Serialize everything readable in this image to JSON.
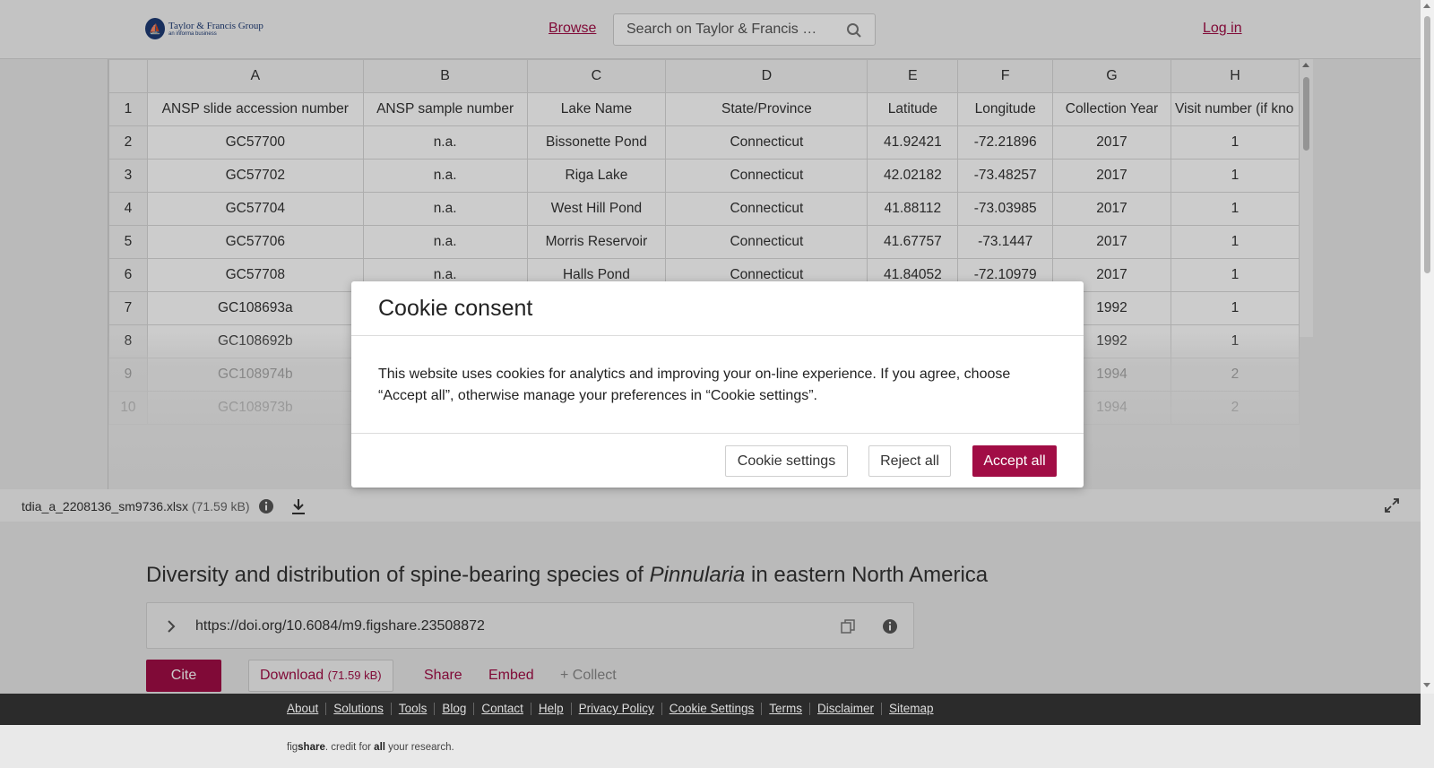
{
  "header": {
    "logo_main": "Taylor & Francis Group",
    "logo_sub": "an informa business",
    "browse_label": "Browse",
    "search_placeholder": "Search on Taylor & Francis …",
    "login_label": "Log in"
  },
  "sheet": {
    "columns": [
      "A",
      "B",
      "C",
      "D",
      "E",
      "F",
      "G",
      "H"
    ],
    "rows": [
      {
        "n": "1",
        "cells": [
          "ANSP slide accession number",
          "ANSP sample number",
          "Lake Name",
          "State/Province",
          "Latitude",
          "Longitude",
          "Collection Year",
          "Visit number (if kno"
        ]
      },
      {
        "n": "2",
        "cells": [
          "GC57700",
          "n.a.",
          "Bissonette Pond",
          "Connecticut",
          "41.92421",
          "-72.21896",
          "2017",
          "1"
        ]
      },
      {
        "n": "3",
        "cells": [
          "GC57702",
          "n.a.",
          "Riga Lake",
          "Connecticut",
          "42.02182",
          "-73.48257",
          "2017",
          "1"
        ]
      },
      {
        "n": "4",
        "cells": [
          "GC57704",
          "n.a.",
          "West Hill Pond",
          "Connecticut",
          "41.88112",
          "-73.03985",
          "2017",
          "1"
        ]
      },
      {
        "n": "5",
        "cells": [
          "GC57706",
          "n.a.",
          "Morris Reservoir",
          "Connecticut",
          "41.67757",
          "-73.1447",
          "2017",
          "1"
        ]
      },
      {
        "n": "6",
        "cells": [
          "GC57708",
          "n.a.",
          "Halls Pond",
          "Connecticut",
          "41.84052",
          "-72.10979",
          "2017",
          "1"
        ]
      },
      {
        "n": "7",
        "cells": [
          "GC108693a",
          "",
          "",
          "",
          "",
          "",
          "1992",
          "1"
        ]
      },
      {
        "n": "8",
        "cells": [
          "GC108692b",
          "",
          "",
          "",
          "",
          "",
          "1992",
          "1"
        ]
      },
      {
        "n": "9",
        "cells": [
          "GC108974b",
          "",
          "",
          "",
          "",
          "",
          "1994",
          "2"
        ]
      },
      {
        "n": "10",
        "cells": [
          "GC108973b",
          "",
          "",
          "",
          "",
          "",
          "1994",
          "2"
        ]
      }
    ]
  },
  "file": {
    "name": "tdia_a_2208136_sm9736.xlsx",
    "size": "(71.59 kB)"
  },
  "article": {
    "title_before": "Diversity and distribution of spine-bearing species of ",
    "title_italic": "Pinnularia",
    "title_after": " in eastern North America",
    "doi": "https://doi.org/10.6084/m9.figshare.23508872"
  },
  "actions": {
    "cite": "Cite",
    "download": "Download",
    "download_size": "(71.59 kB)",
    "share": "Share",
    "embed": "Embed",
    "collect": "+ Collect"
  },
  "footer": {
    "links": [
      "About",
      "Solutions",
      "Tools",
      "Blog",
      "Contact",
      "Help",
      "Privacy Policy",
      "Cookie Settings",
      "Terms",
      "Disclaimer",
      "Sitemap"
    ],
    "tag_fig": "fig",
    "tag_share": "share",
    "tag_mid": ". credit for ",
    "tag_all": "all",
    "tag_end": " your research."
  },
  "cookie": {
    "title": "Cookie consent",
    "body": "This website uses cookies for analytics and improving your on-line experience. If you agree, choose “Accept all”, otherwise manage your preferences in “Cookie settings”.",
    "settings_label": "Cookie settings",
    "reject_label": "Reject all",
    "accept_label": "Accept all"
  },
  "colors": {
    "brand": "#a10d45",
    "footer_bg": "#2b2b2b"
  }
}
